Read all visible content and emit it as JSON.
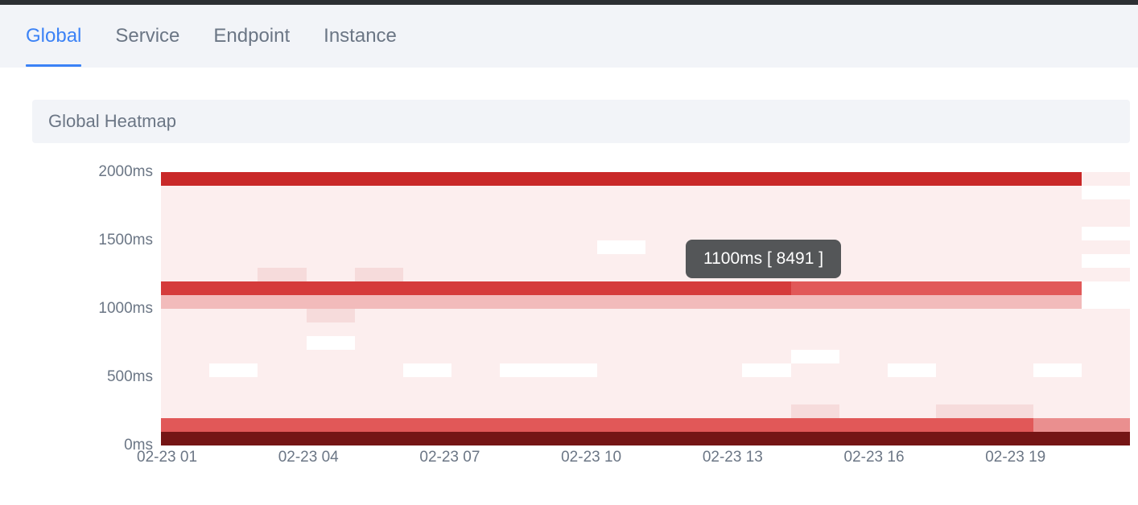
{
  "tabs": {
    "items": [
      {
        "label": "Global",
        "active": true
      },
      {
        "label": "Service",
        "active": false
      },
      {
        "label": "Endpoint",
        "active": false
      },
      {
        "label": "Instance",
        "active": false
      }
    ]
  },
  "panel": {
    "title": "Global Heatmap"
  },
  "tooltip": {
    "text": "1100ms [ 8491 ]"
  },
  "colors": {
    "c0": "#ffffff",
    "c1": "#fceeee",
    "c2": "#f6dbdb",
    "c3": "#f2bbbb",
    "c4": "#ea8f8f",
    "c5": "#e15858",
    "c6": "#d53b3b",
    "c7": "#c92828",
    "c8": "#751515"
  },
  "chart_data": {
    "type": "heatmap",
    "title": "Global Heatmap",
    "xlabel": "",
    "ylabel": "",
    "y_ticks": [
      "0ms",
      "500ms",
      "1000ms",
      "1500ms",
      "2000ms"
    ],
    "x_ticks": [
      "02-23 01",
      "02-23 04",
      "02-23 07",
      "02-23 10",
      "02-23 13",
      "02-23 16",
      "02-23 19"
    ],
    "x_count": 20,
    "y_bins_ms": [
      0,
      100,
      200,
      300,
      400,
      500,
      600,
      700,
      800,
      900,
      1000,
      1100,
      1200,
      1300,
      1400,
      1500,
      1600,
      1700,
      1800,
      1900,
      2000
    ],
    "tooltip_sample": {
      "bin_ms": 1100,
      "count": 8491
    },
    "intensity": [
      [
        7,
        7,
        7,
        7,
        7,
        7,
        7,
        7,
        7,
        7,
        7,
        7,
        7,
        7,
        7,
        7,
        7,
        7,
        7,
        1
      ],
      [
        1,
        1,
        1,
        1,
        1,
        1,
        1,
        1,
        1,
        1,
        1,
        1,
        1,
        1,
        1,
        1,
        1,
        1,
        1,
        0
      ],
      [
        1,
        1,
        1,
        1,
        1,
        1,
        1,
        1,
        1,
        1,
        1,
        1,
        1,
        1,
        1,
        1,
        1,
        1,
        1,
        1
      ],
      [
        1,
        1,
        1,
        1,
        1,
        1,
        1,
        1,
        1,
        1,
        1,
        1,
        1,
        1,
        1,
        1,
        1,
        1,
        1,
        1
      ],
      [
        1,
        1,
        1,
        1,
        1,
        1,
        1,
        1,
        1,
        1,
        1,
        1,
        1,
        1,
        1,
        1,
        1,
        1,
        1,
        0
      ],
      [
        1,
        1,
        1,
        1,
        1,
        1,
        1,
        1,
        1,
        0,
        1,
        1,
        1,
        1,
        1,
        1,
        1,
        1,
        1,
        1
      ],
      [
        1,
        1,
        1,
        1,
        1,
        1,
        1,
        1,
        1,
        1,
        1,
        1,
        1,
        1,
        1,
        1,
        1,
        1,
        1,
        0
      ],
      [
        1,
        1,
        2,
        1,
        2,
        1,
        1,
        1,
        1,
        1,
        1,
        1,
        1,
        1,
        1,
        1,
        1,
        1,
        1,
        1
      ],
      [
        6,
        6,
        6,
        6,
        6,
        6,
        6,
        6,
        6,
        6,
        6,
        6,
        6,
        5,
        5,
        5,
        5,
        5,
        5,
        0
      ],
      [
        3,
        3,
        3,
        3,
        3,
        3,
        3,
        3,
        3,
        3,
        3,
        3,
        3,
        3,
        3,
        3,
        3,
        3,
        3,
        0
      ],
      [
        1,
        1,
        1,
        2,
        1,
        1,
        1,
        1,
        1,
        1,
        1,
        1,
        1,
        1,
        1,
        1,
        1,
        1,
        1,
        1
      ],
      [
        1,
        1,
        1,
        1,
        1,
        1,
        1,
        1,
        1,
        1,
        1,
        1,
        1,
        1,
        1,
        1,
        1,
        1,
        1,
        1
      ],
      [
        1,
        1,
        1,
        0,
        1,
        1,
        1,
        1,
        1,
        1,
        1,
        1,
        1,
        1,
        1,
        1,
        1,
        1,
        1,
        1
      ],
      [
        1,
        1,
        1,
        1,
        1,
        1,
        1,
        1,
        1,
        1,
        1,
        1,
        1,
        0,
        1,
        1,
        1,
        1,
        1,
        1
      ],
      [
        1,
        0,
        1,
        1,
        1,
        0,
        1,
        0,
        0,
        1,
        1,
        1,
        0,
        1,
        1,
        0,
        1,
        1,
        0,
        1
      ],
      [
        1,
        1,
        1,
        1,
        1,
        1,
        1,
        1,
        1,
        1,
        1,
        1,
        1,
        1,
        1,
        1,
        1,
        1,
        1,
        1
      ],
      [
        1,
        1,
        1,
        1,
        1,
        1,
        1,
        1,
        1,
        1,
        1,
        1,
        1,
        1,
        1,
        1,
        1,
        1,
        1,
        1
      ],
      [
        1,
        1,
        1,
        1,
        1,
        1,
        1,
        1,
        1,
        1,
        1,
        1,
        1,
        2,
        1,
        1,
        2,
        2,
        1,
        1
      ],
      [
        5,
        5,
        5,
        5,
        5,
        5,
        5,
        5,
        5,
        5,
        5,
        5,
        5,
        5,
        5,
        5,
        5,
        5,
        4,
        4
      ],
      [
        8,
        8,
        8,
        8,
        8,
        8,
        8,
        8,
        8,
        8,
        8,
        8,
        8,
        8,
        8,
        8,
        8,
        8,
        8,
        8
      ]
    ]
  }
}
